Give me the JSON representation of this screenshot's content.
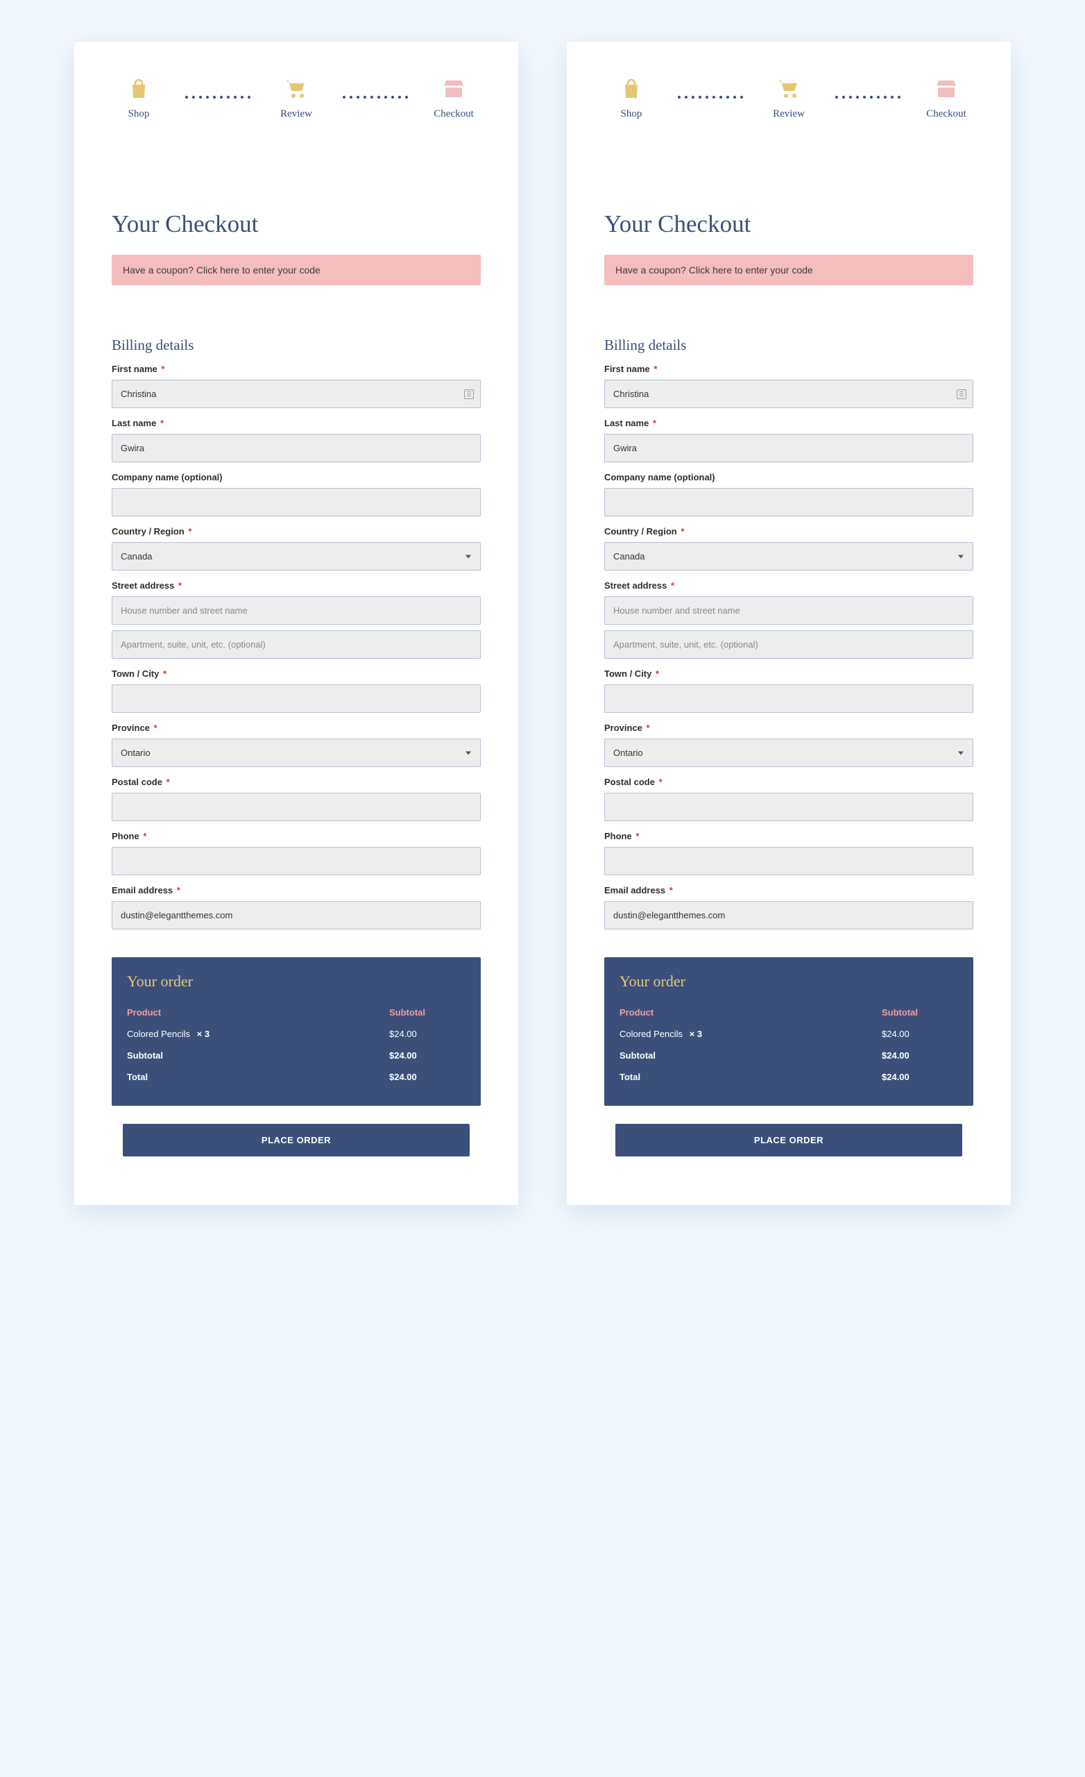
{
  "progress": {
    "steps": [
      {
        "label": "Shop",
        "icon": "bag-icon"
      },
      {
        "label": "Review",
        "icon": "cart-icon"
      },
      {
        "label": "Checkout",
        "icon": "store-icon"
      }
    ]
  },
  "page": {
    "title": "Your Checkout",
    "coupon_prefix": "Have a coupon? ",
    "coupon_link": "Click here to enter your code",
    "billing_title": "Billing details",
    "order_title": "Your order",
    "place_order": "PLACE ORDER",
    "asterisk": "*"
  },
  "billing_fields": {
    "first_name": {
      "label": "First name",
      "required": true,
      "value": "Christina",
      "placeholder": ""
    },
    "last_name": {
      "label": "Last name",
      "required": true,
      "value": "Gwira",
      "placeholder": ""
    },
    "company": {
      "label": "Company name (optional)",
      "required": false,
      "value": "",
      "placeholder": ""
    },
    "country": {
      "label": "Country / Region",
      "required": true,
      "value": "Canada"
    },
    "street": {
      "label": "Street address",
      "required": true,
      "line1_value": "",
      "line1_placeholder": "House number and street name",
      "line2_value": "",
      "line2_placeholder": "Apartment, suite, unit, etc. (optional)"
    },
    "city": {
      "label": "Town / City",
      "required": true,
      "value": ""
    },
    "province": {
      "label": "Province",
      "required": true,
      "value": "Ontario"
    },
    "postal": {
      "label": "Postal code",
      "required": true,
      "value": ""
    },
    "phone": {
      "label": "Phone",
      "required": true,
      "value": ""
    },
    "email": {
      "label": "Email address",
      "required": true,
      "value": "dustin@elegantthemes.com"
    }
  },
  "order": {
    "head": {
      "product": "Product",
      "subtotal": "Subtotal"
    },
    "items": [
      {
        "name": "Colored Pencils",
        "qty_label": "× 3",
        "amount": "$24.00"
      }
    ],
    "subtotal": {
      "label": "Subtotal",
      "amount": "$24.00"
    },
    "total": {
      "label": "Total",
      "amount": "$24.00"
    }
  }
}
